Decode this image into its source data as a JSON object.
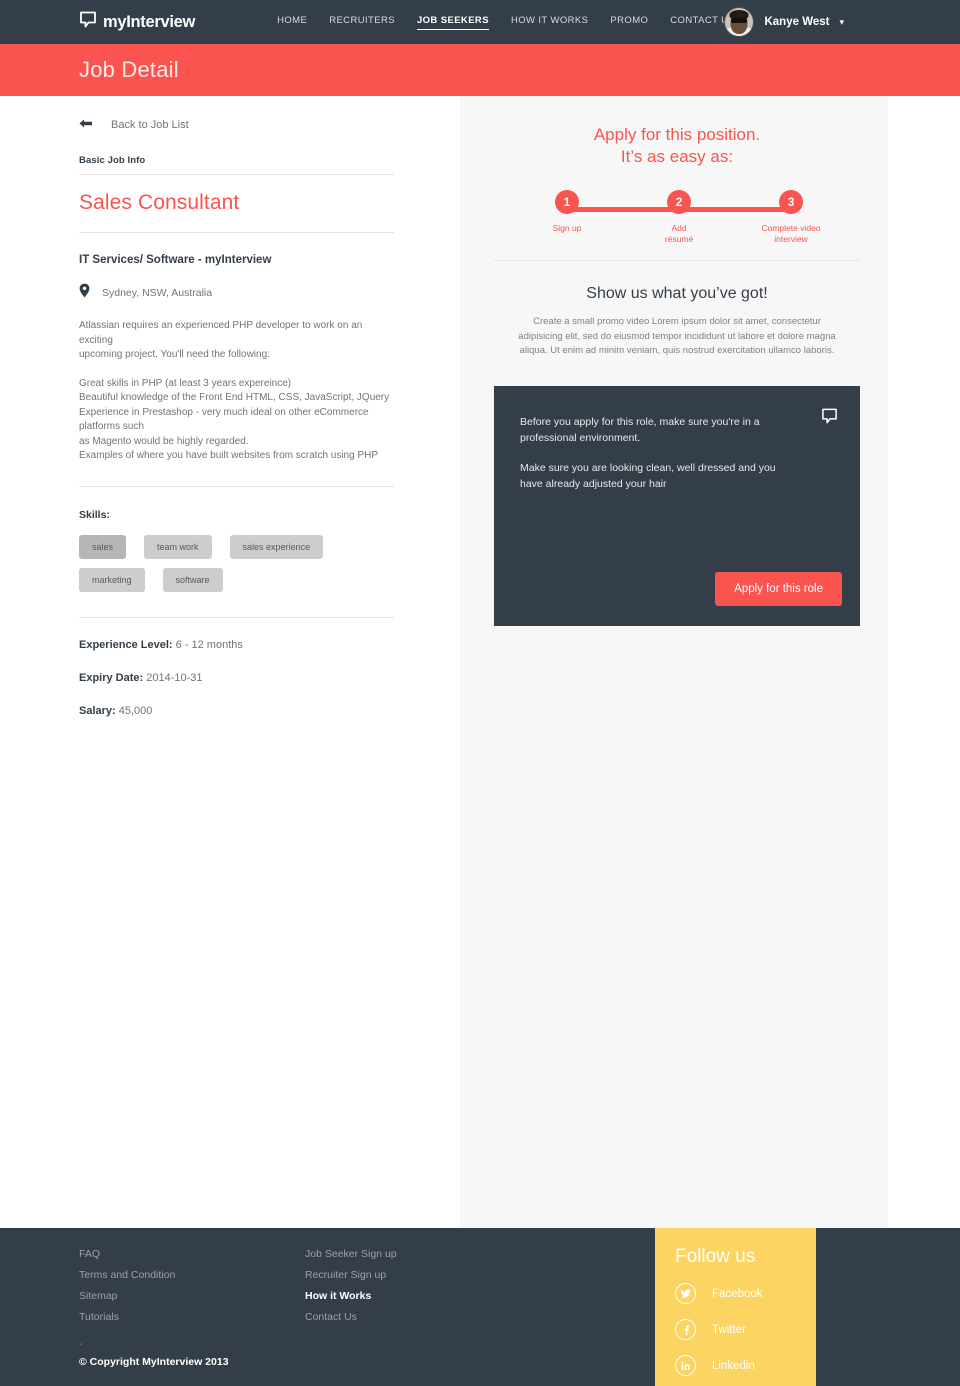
{
  "nav": {
    "logo_text": "myInterview",
    "items": [
      {
        "label": "HOME",
        "active": false
      },
      {
        "label": "RECRUITERS",
        "active": false
      },
      {
        "label": "JOB SEEKERS",
        "active": true
      },
      {
        "label": "HOW IT WORKS",
        "active": false
      },
      {
        "label": "PROMO",
        "active": false
      },
      {
        "label": "CONTACT US",
        "active": false
      }
    ],
    "user_name": "Kanye West",
    "caret": "▾"
  },
  "banner": {
    "title": "Job Detail"
  },
  "left": {
    "back_label": "Back to Job List",
    "basic_info_label": "Basic Job Info",
    "job_title": "Sales Consultant",
    "company": "IT Services/ Software - myInterview",
    "location": "Sydney, NSW, Australia",
    "description_1": "Atlassian requires an experienced PHP developer to work on an exciting\nupcoming project.  You'll need the following:",
    "description_2": "Great skills in PHP (at least 3 years expereince)\nBeautiful knowledge of the Front End HTML, CSS, JavaScript, JQuery\nExperience in Prestashop - very much ideal on other eCommerce platforms such\nas Magento would be highly regarded.\nExamples of where you have built websites from scratch using PHP",
    "skills_label": "Skills:",
    "skills": [
      {
        "label": "sales",
        "selected": true
      },
      {
        "label": "team work",
        "selected": false
      },
      {
        "label": "sales experience",
        "selected": false
      },
      {
        "label": "marketing",
        "selected": false
      },
      {
        "label": "software",
        "selected": false
      }
    ],
    "experience_key": "Experience Level:",
    "experience_value": " 6 - 12 months",
    "expiry_key": "Expiry Date:",
    "expiry_value": " 2014-10-31",
    "salary_key": "Salary:",
    "salary_value": " 45,000"
  },
  "right": {
    "apply_heading_line1": "Apply for this position.",
    "apply_heading_line2": "It’s as easy as:",
    "steps": [
      {
        "number": "1",
        "label": "Sign up"
      },
      {
        "number": "2",
        "label": "Add\nrésumé"
      },
      {
        "number": "3",
        "label": "Complete video\ninterview"
      }
    ],
    "show_heading": "Show us what you’ve got!",
    "show_body": "Create a small promo video Lorem ipsum dolor sit amet, consectetur adipisicing elit, sed do eiusmod tempor incididunt ut labore et dolore magna aliqua. Ut enim ad minim veniam, quis nostrud exercitation ullamco laboris.",
    "card_text_1": "Before you apply for this role, make sure you're in a\nprofessional environment.",
    "card_text_2": "Make sure you are looking clean, well dressed and you\nhave already adjusted your hair",
    "apply_button": "Apply for this role"
  },
  "footer": {
    "column_1": [
      {
        "label": "FAQ",
        "bold": false
      },
      {
        "label": "Terms and Condition",
        "bold": false
      },
      {
        "label": "Sitemap",
        "bold": false
      },
      {
        "label": "Tutorials",
        "bold": false
      }
    ],
    "column_2": [
      {
        "label": "Job Seeker Sign up",
        "bold": false
      },
      {
        "label": "Recruiter Sign up",
        "bold": false
      },
      {
        "label": "How it Works",
        "bold": true
      },
      {
        "label": "Contact Us",
        "bold": false
      }
    ],
    "dash": "-",
    "copyright": "© Copyright MyInterview 2013",
    "social_heading": "Follow us",
    "social": [
      {
        "label": "Facebook",
        "icon": "twitter-bird-icon"
      },
      {
        "label": "Twitter",
        "icon": "facebook-f-icon"
      },
      {
        "label": "Linkedin",
        "icon": "linkedin-in-icon"
      }
    ]
  },
  "colors": {
    "accent_red": "#f9544f",
    "dark_navy": "#343e48",
    "social_yellow": "#fcd462",
    "panel_gray": "#f7f7f7"
  }
}
